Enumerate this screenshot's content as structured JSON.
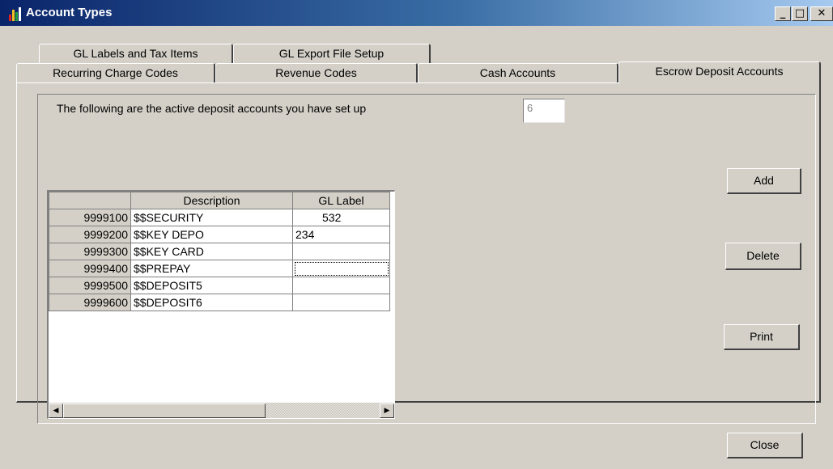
{
  "window": {
    "title": "Account Types",
    "minimize_label": "_",
    "maximize_label": "□",
    "close_label": "✕"
  },
  "tabs_row_back": [
    "GL Labels and Tax Items",
    "GL Export File Setup"
  ],
  "tabs_row_front": [
    "Recurring Charge Codes",
    "Revenue Codes",
    "Cash Accounts",
    "Escrow Deposit Accounts"
  ],
  "active_tab": "Escrow Deposit Accounts",
  "message": "The following are the active deposit accounts you have set up",
  "count": "6",
  "buttons": {
    "add": "Add",
    "delete": "Delete",
    "print": "Print",
    "close": "Close"
  },
  "grid": {
    "headers": [
      "",
      "Description",
      "GL Label"
    ],
    "rows": [
      {
        "code": "9999100",
        "description": "$$SECURITY",
        "gl_label": "532"
      },
      {
        "code": "9999200",
        "description": "$$KEY DEPO",
        "gl_label": "234"
      },
      {
        "code": "9999300",
        "description": "$$KEY CARD",
        "gl_label": ""
      },
      {
        "code": "9999400",
        "description": "$$PREPAY",
        "gl_label": ""
      },
      {
        "code": "9999500",
        "description": "$$DEPOSIT5",
        "gl_label": ""
      },
      {
        "code": "9999600",
        "description": "$$DEPOSIT6",
        "gl_label": ""
      }
    ],
    "scroll_left": "◀",
    "scroll_right": "▶"
  },
  "colors": {
    "titlebar_start": "#0a246a",
    "titlebar_end": "#a6caf0",
    "face": "#d4d0c8",
    "shadow": "#404040"
  },
  "icons": [
    "app-chart-icon",
    "minimize-icon",
    "maximize-icon",
    "close-icon",
    "scroll-left-arrow-icon",
    "scroll-right-arrow-icon"
  ]
}
